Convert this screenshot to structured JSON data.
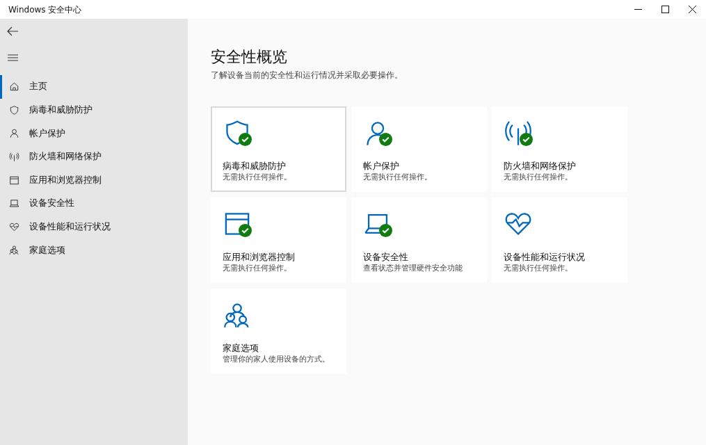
{
  "window": {
    "title": "Windows 安全中心"
  },
  "sidebar": {
    "items": [
      {
        "kind": "home",
        "label": "主页",
        "selected": true
      },
      {
        "kind": "shield",
        "label": "病毒和威胁防护",
        "selected": false
      },
      {
        "kind": "person",
        "label": "帐户保护",
        "selected": false
      },
      {
        "kind": "antenna",
        "label": "防火墙和网络保护",
        "selected": false
      },
      {
        "kind": "browser",
        "label": "应用和浏览器控制",
        "selected": false
      },
      {
        "kind": "laptop",
        "label": "设备安全性",
        "selected": false
      },
      {
        "kind": "heart",
        "label": "设备性能和运行状况",
        "selected": false
      },
      {
        "kind": "family",
        "label": "家庭选项",
        "selected": false
      }
    ]
  },
  "main": {
    "title": "安全性概览",
    "subtitle": "了解设备当前的安全性和运行情况并采取必要操作。",
    "cards": [
      {
        "kind": "shield",
        "title": "病毒和威胁防护",
        "status": "无需执行任何操作。",
        "ok": true,
        "selected": true
      },
      {
        "kind": "person",
        "title": "帐户保护",
        "status": "无需执行任何操作。",
        "ok": true,
        "selected": false
      },
      {
        "kind": "antenna",
        "title": "防火墙和网络保护",
        "status": "无需执行任何操作。",
        "ok": true,
        "selected": false
      },
      {
        "kind": "browser",
        "title": "应用和浏览器控制",
        "status": "无需执行任何操作。",
        "ok": true,
        "selected": false
      },
      {
        "kind": "laptop",
        "title": "设备安全性",
        "status": "查看状态并管理硬件安全功能",
        "ok": true,
        "selected": false
      },
      {
        "kind": "heart",
        "title": "设备性能和运行状况",
        "status": "无需执行任何操作。",
        "ok": false,
        "selected": false
      },
      {
        "kind": "family",
        "title": "家庭选项",
        "status": "管理你的家人使用设备的方式。",
        "ok": false,
        "selected": false
      }
    ]
  }
}
